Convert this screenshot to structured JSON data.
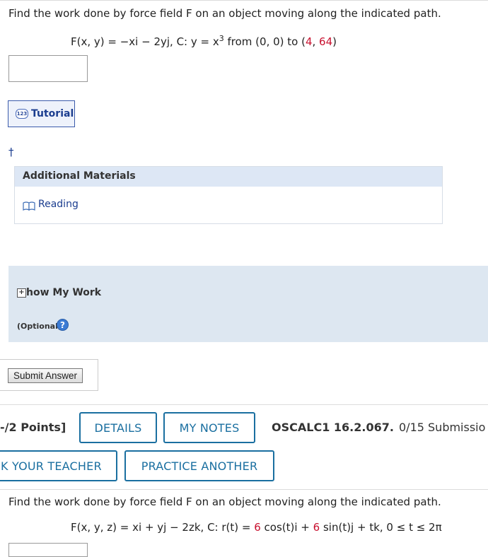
{
  "question1": {
    "prompt": "Find the work done by force field F on an object moving along the indicated path.",
    "equation": {
      "lhs": "F(x, y) = −xi − 2yj, C: y = x",
      "exponent": "3",
      "mid": " from (0, 0) to (",
      "x_end": "4",
      "comma": ", ",
      "y_end": "64",
      "close": ")"
    },
    "answer_value": ""
  },
  "tutorial": {
    "icon_text": "123",
    "label": "Tutorial"
  },
  "dagger": "†",
  "additional_materials": {
    "title": "Additional Materials",
    "reading_label": "Reading"
  },
  "show_my_work": {
    "title": "how My Work",
    "optional": "(Optional)",
    "help": "?"
  },
  "submit_label": "Submit Answer",
  "question2": {
    "points": "-/2 Points]",
    "details_label": "DETAILS",
    "notes_label": "MY NOTES",
    "id": "OSCALC1 16.2.067.",
    "submissions": "0/15 Submissio",
    "ask_teacher_label": "K YOUR TEACHER",
    "practice_label": "PRACTICE ANOTHER",
    "prompt": "Find the work done by force field F on an object moving along the indicated path.",
    "equation": {
      "a": "F(x, y, z) = xi + yj − 2zk, C: r(t) = ",
      "c1": "6",
      "b": " cos(t)i + ",
      "c2": "6",
      "c": " sin(t)j + tk, 0 ≤ t ≤ 2π"
    }
  },
  "colors": {
    "accent": "#1a6fa0",
    "link": "#1b3d8f",
    "red": "#c8102e",
    "panel": "#dde7f1"
  }
}
